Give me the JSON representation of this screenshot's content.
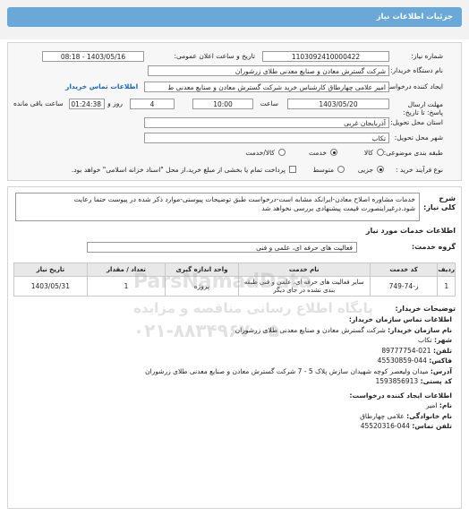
{
  "header": {
    "title": "جزئیات اطلاعات نیاز"
  },
  "form": {
    "need_number_label": "شماره نیاز:",
    "need_number": "1103092410000422",
    "announce_label": "تاریخ و ساعت اعلان عمومی:",
    "announce_value": "1403/05/16 - 08:18",
    "buyer_label": "نام دستگاه خریدار:",
    "buyer_value": "شرکت گسترش معادن و صنایع معدنی طلای زرشوران",
    "creator_label": "ایجاد کننده درخواست:",
    "creator_value": "امیر  علامی چهارطاق کارشناس خرید شرکت گسترش معادن و صنایع معدنی ط",
    "contact_link": "اطلاعات تماس خریدار",
    "deadline_label": "مهلت ارسال پاسخ: تا تاریخ:",
    "deadline_date": "1403/05/20",
    "time_label": "ساعت",
    "deadline_time": "10:00",
    "days_value": "4",
    "days_label": "روز و",
    "remaining_time": "01:24:38",
    "remaining_label": "ساعت باقی مانده",
    "province_label": "استان محل تحویل:",
    "province_value": "آذربایجان غربی",
    "city_label": "شهر محل تحویل:",
    "city_value": "تکاب",
    "category_label": "طبقه بندی موضوعی:",
    "category_options": [
      "کالا",
      "خدمت",
      "کالا/خدمت"
    ],
    "category_selected": "خدمت",
    "purchase_label": "نوع فرآیند خرید :",
    "purchase_options": [
      "جزیی",
      "متوسط"
    ],
    "purchase_selected": "جزیی",
    "payment_note": "پرداخت تمام یا بخشی از مبلغ خرید،از محل \"اسناد خزانه اسلامی\" خواهد بود."
  },
  "description": {
    "label": "شرح کلی نیاز:",
    "text": "خدمات مشاوره اصلاح معادن-ایرانکد مشابه است-درخواست طبق توضیحات پیوستی-موارد ذکر شده در پیوست حتما رعایت شود.درغیراینصورت قیمت پیشنهادی بررسی نخواهد شد"
  },
  "services": {
    "title": "اطلاعات خدمات مورد نیاز",
    "group_label": "گروه خدمت:",
    "group_value": "فعالیت های حرفه ای، علمی و فنی",
    "columns": [
      "ردیف",
      "کد خدمت",
      "نام خدمت",
      "واحد اندازه گیری",
      "تعداد / مقدار",
      "تاریخ نیاز"
    ],
    "rows": [
      {
        "index": "1",
        "code": "ز-74-749",
        "name": "سایر فعالیت های حرفه ای، علمی و فنی طبقه بندی نشده در جای دیگر",
        "unit": "پروژه",
        "qty": "1",
        "date": "1403/05/31"
      }
    ],
    "buyer_notes_label": "توضیحات خریدار:"
  },
  "buyer_contact": {
    "title": "اطلاعات تماس سازمان خریدار:",
    "org_label": "نام سازمان خریدار:",
    "org_value": "شرکت گسترش معادن و صنایع معدنی طلای زرشوران",
    "city_label": "شهر:",
    "city_value": "تکاب",
    "phone_label": "تلفن:",
    "phone_value": "021-89777754",
    "fax_label": "فاکس:",
    "fax_value": "044-45530859",
    "address_label": "آدرس:",
    "address_value": "میدان ولیعصر کوچه شهیدان سازش پلاک 5 - 7 شرکت گسترش معادن و صنایع معدنی طلای زرشوران",
    "postal_label": "کد پستی:",
    "postal_value": "1593856913"
  },
  "creator_contact": {
    "title": "اطلاعات ایجاد کننده درخواست:",
    "name_label": "نام:",
    "name_value": "امیر",
    "family_label": "نام خانوادگی:",
    "family_value": "علامی چهارطاق",
    "phone_label": "تلفن تماس:",
    "phone_value": "044-45520316"
  },
  "watermark": {
    "brand": "ParsNamadData",
    "line1": "پایگاه اطلاع رسانی مناقصه و مزایده",
    "line2": "۰۲۱-۸۸۳۴۹۶۷۰-۵"
  },
  "colors": {
    "header": "#6aa8d8",
    "link": "#1a66c2",
    "panel_bg": "#f7f7f7"
  }
}
